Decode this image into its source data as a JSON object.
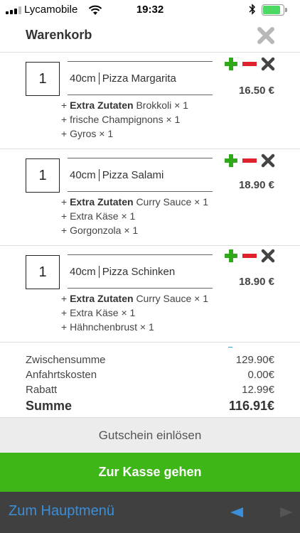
{
  "status": {
    "carrier": "Lycamobile",
    "time": "19:32",
    "signal_bars_filled": 3,
    "battery_level": 0.85
  },
  "header": {
    "title": "Warenkorb",
    "close_icon": "close-icon"
  },
  "items": [
    {
      "qty": "1",
      "size": "40cm",
      "name": "Pizza Margarita",
      "price": "16.50 €",
      "extras_label": "Extra Zutaten",
      "extras": [
        "Brokkoli × 1",
        "frische Champignons × 1",
        "Gyros × 1"
      ]
    },
    {
      "qty": "1",
      "size": "40cm",
      "name": "Pizza Salami",
      "price": "18.90 €",
      "extras_label": "Extra Zutaten",
      "extras": [
        "Curry Sauce × 1",
        "Extra Käse × 1",
        "Gorgonzola × 1"
      ]
    },
    {
      "qty": "1",
      "size": "40cm",
      "name": "Pizza Schinken",
      "price": "18.90 €",
      "extras_label": "Extra Zutaten",
      "extras": [
        "Curry Sauce × 1",
        "Extra Käse × 1",
        "Hähnchenbrust × 1"
      ]
    }
  ],
  "totals": {
    "subtotal_label": "Zwischensumme",
    "subtotal_value": "129.90€",
    "delivery_label": "Anfahrtskosten",
    "delivery_value": "0.00€",
    "discount_label": "Rabatt",
    "discount_value": "12.99€",
    "sum_label": "Summe",
    "sum_value": "116.91€"
  },
  "voucher_label": "Gutschein einlösen",
  "checkout_label": "Zur Kasse gehen",
  "bottom": {
    "main_menu_label": "Zum Hauptmenü"
  },
  "colors": {
    "plus": "#2fa81a",
    "minus": "#e0202a",
    "remove": "#444444",
    "checkout": "#3fb618",
    "link": "#3b8ed8",
    "bottombar": "#404040"
  }
}
